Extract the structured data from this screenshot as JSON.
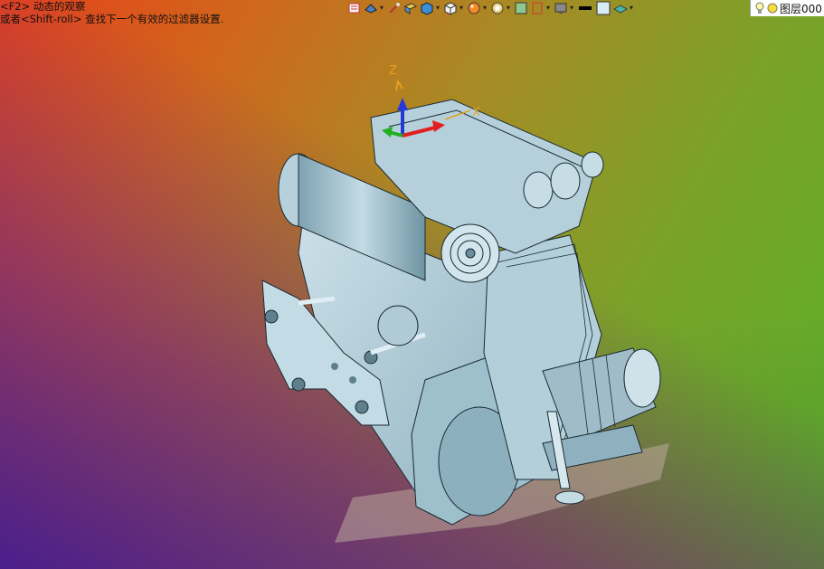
{
  "hints": {
    "line1": "<F2> 动态的观察",
    "line2": "或者<Shift-roll> 查找下一个有效的过滤器设置."
  },
  "toolbar": {
    "icons": [
      "view-orient-icon",
      "render-mode-icon",
      "section-icon",
      "shade-icon",
      "box-view-icon",
      "cube-view-icon",
      "appearance-icon",
      "zoom-icon",
      "fit-icon",
      "frame-icon",
      "display-icon",
      "line-color-icon",
      "color-swatch-icon",
      "layer-shape-icon"
    ]
  },
  "layer": {
    "label": "图层000",
    "icons": [
      "light-bulb-icon",
      "sun-icon"
    ]
  },
  "triad": {
    "z_label": "Z",
    "x_label": "X"
  },
  "colors": {
    "model_fill": "#a9c8d4",
    "model_dark": "#6e93a2",
    "edge": "#1a2a33"
  }
}
